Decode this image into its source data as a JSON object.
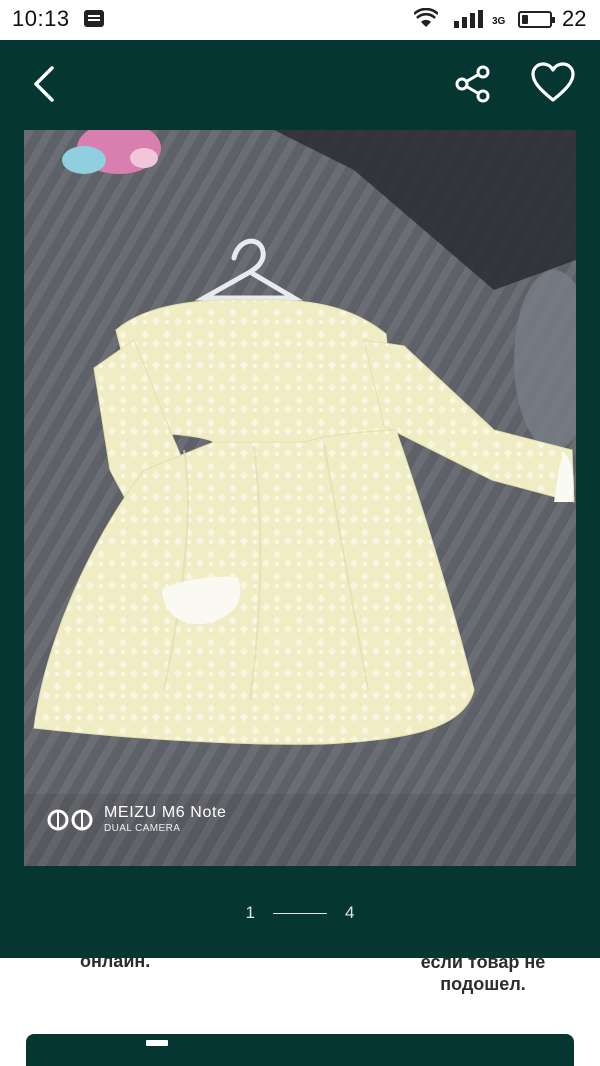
{
  "status_bar": {
    "time": "10:13",
    "network_type": "3G",
    "battery_level": 22,
    "battery_text": "22"
  },
  "gallery": {
    "back_icon": "chevron-left-icon",
    "share_icon": "share-icon",
    "favorite_icon": "heart-outline-icon",
    "photo_watermark": {
      "brand": "MEIZU M6 Note",
      "sub": "DUAL CAMERA"
    },
    "pager": {
      "current": "1",
      "total": "4"
    }
  },
  "below": {
    "left_text": "онлайн.",
    "right_text_line1": "если товар не",
    "right_text_line2": "подошел."
  },
  "colors": {
    "header_bg": "#053632",
    "accent": "#053632"
  }
}
